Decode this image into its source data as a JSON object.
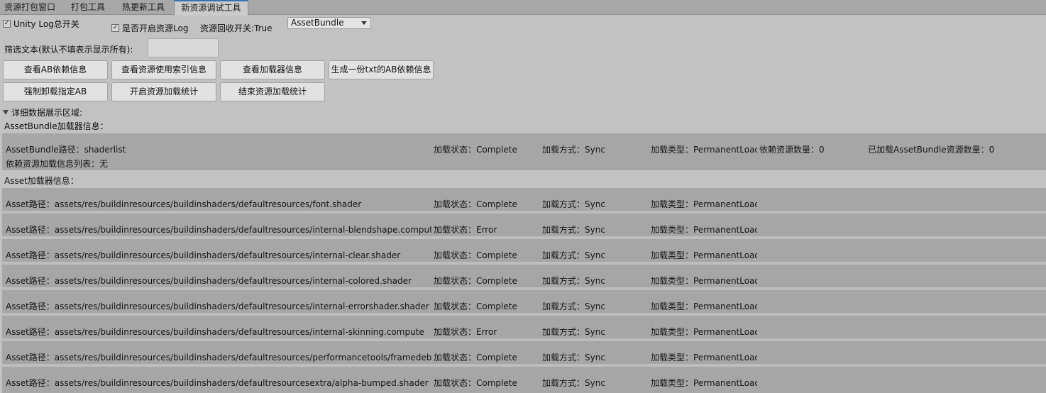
{
  "tabs": [
    "资源打包窗口",
    "打包工具",
    "热更新工具",
    "新资源调试工具"
  ],
  "toolbar": {
    "unity_log_label": "Unity Log总开关",
    "unity_log_checked": true,
    "resource_log_label": "是否开启资源Log",
    "resource_log_checked": true,
    "recycle_label": "资源回收开关:True",
    "dropdown_value": "AssetBundle"
  },
  "filter": {
    "label": "筛选文本(默认不填表示显示所有):",
    "value": ""
  },
  "buttons": {
    "row1": [
      "查看AB依赖信息",
      "查看资源使用索引信息",
      "查看加载器信息",
      "生成一份txt的AB依赖信息"
    ],
    "row2": [
      "强制卸载指定AB",
      "开启资源加载统计",
      "结束资源加载统计"
    ]
  },
  "details": {
    "foldout_label": "详细数据展示区域:",
    "ab_section_title": "AssetBundle加载器信息：",
    "ab_loader": {
      "path": "AssetBundle路径：shaderlist",
      "state": "加载状态：Complete",
      "method": "加载方式：Sync",
      "type": "加载类型：PermanentLoad",
      "dep_count": "依赖资源数量：0",
      "loaded_count": "已加载AssetBundle资源数量：0",
      "dep_list": "依赖资源加载信息列表：无"
    },
    "asset_section_title": "Asset加载器信息：",
    "asset_loaders": [
      {
        "path": "Asset路径：assets/res/buildinresources/buildinshaders/defaultresources/font.shader",
        "state": "加载状态：Complete",
        "method": "加载方式：Sync",
        "type": "加载类型：PermanentLoad"
      },
      {
        "path": "Asset路径：assets/res/buildinresources/buildinshaders/defaultresources/internal-blendshape.compute",
        "state": "加载状态：Error",
        "method": "加载方式：Sync",
        "type": "加载类型：PermanentLoad"
      },
      {
        "path": "Asset路径：assets/res/buildinresources/buildinshaders/defaultresources/internal-clear.shader",
        "state": "加载状态：Complete",
        "method": "加载方式：Sync",
        "type": "加载类型：PermanentLoad"
      },
      {
        "path": "Asset路径：assets/res/buildinresources/buildinshaders/defaultresources/internal-colored.shader",
        "state": "加载状态：Complete",
        "method": "加载方式：Sync",
        "type": "加载类型：PermanentLoad"
      },
      {
        "path": "Asset路径：assets/res/buildinresources/buildinshaders/defaultresources/internal-errorshader.shader",
        "state": "加载状态：Complete",
        "method": "加载方式：Sync",
        "type": "加载类型：PermanentLoad"
      },
      {
        "path": "Asset路径：assets/res/buildinresources/buildinshaders/defaultresources/internal-skinning.compute",
        "state": "加载状态：Error",
        "method": "加载方式：Sync",
        "type": "加载类型：PermanentLoad"
      },
      {
        "path": "Asset路径：assets/res/buildinresources/buildinshaders/defaultresources/performancetools/framedebuggerre",
        "state": "加载状态：Complete",
        "method": "加载方式：Sync",
        "type": "加载类型：PermanentLoad"
      },
      {
        "path": "Asset路径：assets/res/buildinresources/buildinshaders/defaultresourcesextra/alpha-bumped.shader",
        "state": "加载状态：Complete",
        "method": "加载方式：Sync",
        "type": "加载类型：PermanentLoad"
      }
    ]
  }
}
